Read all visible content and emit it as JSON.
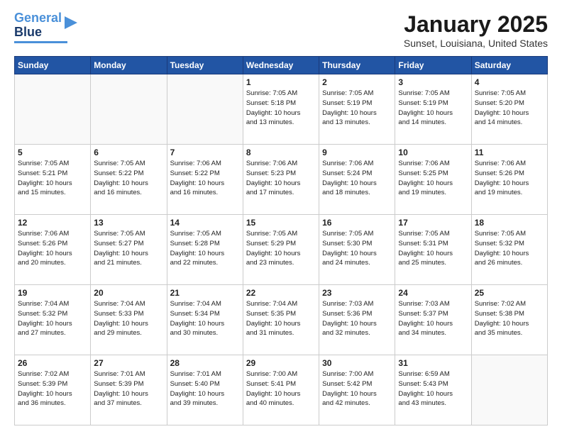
{
  "logo": {
    "line1": "General",
    "line2": "Blue"
  },
  "header": {
    "title": "January 2025",
    "subtitle": "Sunset, Louisiana, United States"
  },
  "weekdays": [
    "Sunday",
    "Monday",
    "Tuesday",
    "Wednesday",
    "Thursday",
    "Friday",
    "Saturday"
  ],
  "weeks": [
    [
      {
        "day": "",
        "info": ""
      },
      {
        "day": "",
        "info": ""
      },
      {
        "day": "",
        "info": ""
      },
      {
        "day": "1",
        "info": "Sunrise: 7:05 AM\nSunset: 5:18 PM\nDaylight: 10 hours\nand 13 minutes."
      },
      {
        "day": "2",
        "info": "Sunrise: 7:05 AM\nSunset: 5:19 PM\nDaylight: 10 hours\nand 13 minutes."
      },
      {
        "day": "3",
        "info": "Sunrise: 7:05 AM\nSunset: 5:19 PM\nDaylight: 10 hours\nand 14 minutes."
      },
      {
        "day": "4",
        "info": "Sunrise: 7:05 AM\nSunset: 5:20 PM\nDaylight: 10 hours\nand 14 minutes."
      }
    ],
    [
      {
        "day": "5",
        "info": "Sunrise: 7:05 AM\nSunset: 5:21 PM\nDaylight: 10 hours\nand 15 minutes."
      },
      {
        "day": "6",
        "info": "Sunrise: 7:05 AM\nSunset: 5:22 PM\nDaylight: 10 hours\nand 16 minutes."
      },
      {
        "day": "7",
        "info": "Sunrise: 7:06 AM\nSunset: 5:22 PM\nDaylight: 10 hours\nand 16 minutes."
      },
      {
        "day": "8",
        "info": "Sunrise: 7:06 AM\nSunset: 5:23 PM\nDaylight: 10 hours\nand 17 minutes."
      },
      {
        "day": "9",
        "info": "Sunrise: 7:06 AM\nSunset: 5:24 PM\nDaylight: 10 hours\nand 18 minutes."
      },
      {
        "day": "10",
        "info": "Sunrise: 7:06 AM\nSunset: 5:25 PM\nDaylight: 10 hours\nand 19 minutes."
      },
      {
        "day": "11",
        "info": "Sunrise: 7:06 AM\nSunset: 5:26 PM\nDaylight: 10 hours\nand 19 minutes."
      }
    ],
    [
      {
        "day": "12",
        "info": "Sunrise: 7:06 AM\nSunset: 5:26 PM\nDaylight: 10 hours\nand 20 minutes."
      },
      {
        "day": "13",
        "info": "Sunrise: 7:05 AM\nSunset: 5:27 PM\nDaylight: 10 hours\nand 21 minutes."
      },
      {
        "day": "14",
        "info": "Sunrise: 7:05 AM\nSunset: 5:28 PM\nDaylight: 10 hours\nand 22 minutes."
      },
      {
        "day": "15",
        "info": "Sunrise: 7:05 AM\nSunset: 5:29 PM\nDaylight: 10 hours\nand 23 minutes."
      },
      {
        "day": "16",
        "info": "Sunrise: 7:05 AM\nSunset: 5:30 PM\nDaylight: 10 hours\nand 24 minutes."
      },
      {
        "day": "17",
        "info": "Sunrise: 7:05 AM\nSunset: 5:31 PM\nDaylight: 10 hours\nand 25 minutes."
      },
      {
        "day": "18",
        "info": "Sunrise: 7:05 AM\nSunset: 5:32 PM\nDaylight: 10 hours\nand 26 minutes."
      }
    ],
    [
      {
        "day": "19",
        "info": "Sunrise: 7:04 AM\nSunset: 5:32 PM\nDaylight: 10 hours\nand 27 minutes."
      },
      {
        "day": "20",
        "info": "Sunrise: 7:04 AM\nSunset: 5:33 PM\nDaylight: 10 hours\nand 29 minutes."
      },
      {
        "day": "21",
        "info": "Sunrise: 7:04 AM\nSunset: 5:34 PM\nDaylight: 10 hours\nand 30 minutes."
      },
      {
        "day": "22",
        "info": "Sunrise: 7:04 AM\nSunset: 5:35 PM\nDaylight: 10 hours\nand 31 minutes."
      },
      {
        "day": "23",
        "info": "Sunrise: 7:03 AM\nSunset: 5:36 PM\nDaylight: 10 hours\nand 32 minutes."
      },
      {
        "day": "24",
        "info": "Sunrise: 7:03 AM\nSunset: 5:37 PM\nDaylight: 10 hours\nand 34 minutes."
      },
      {
        "day": "25",
        "info": "Sunrise: 7:02 AM\nSunset: 5:38 PM\nDaylight: 10 hours\nand 35 minutes."
      }
    ],
    [
      {
        "day": "26",
        "info": "Sunrise: 7:02 AM\nSunset: 5:39 PM\nDaylight: 10 hours\nand 36 minutes."
      },
      {
        "day": "27",
        "info": "Sunrise: 7:01 AM\nSunset: 5:39 PM\nDaylight: 10 hours\nand 37 minutes."
      },
      {
        "day": "28",
        "info": "Sunrise: 7:01 AM\nSunset: 5:40 PM\nDaylight: 10 hours\nand 39 minutes."
      },
      {
        "day": "29",
        "info": "Sunrise: 7:00 AM\nSunset: 5:41 PM\nDaylight: 10 hours\nand 40 minutes."
      },
      {
        "day": "30",
        "info": "Sunrise: 7:00 AM\nSunset: 5:42 PM\nDaylight: 10 hours\nand 42 minutes."
      },
      {
        "day": "31",
        "info": "Sunrise: 6:59 AM\nSunset: 5:43 PM\nDaylight: 10 hours\nand 43 minutes."
      },
      {
        "day": "",
        "info": ""
      }
    ]
  ]
}
